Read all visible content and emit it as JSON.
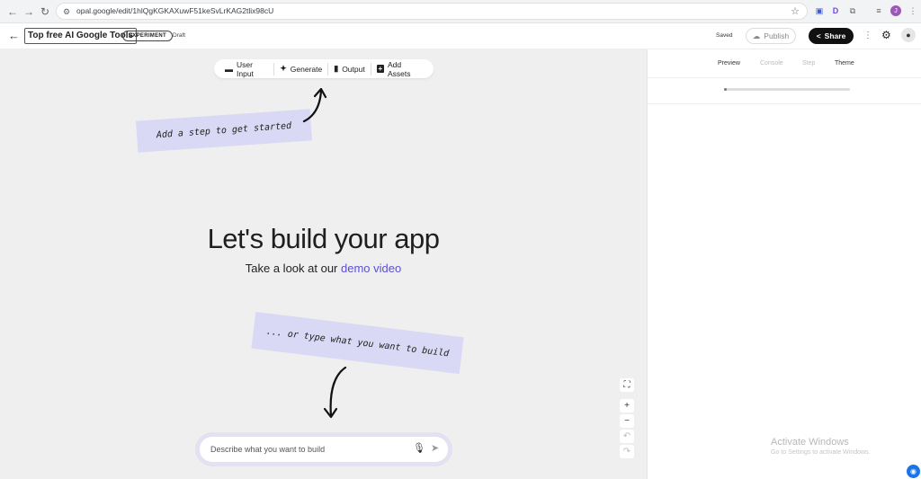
{
  "browser": {
    "url": "opal.google/edit/1hlQgKGKAXuwF51keSvLrKAG2tlix98cU",
    "back_icon": "←",
    "forward_icon": "→",
    "reload_icon": "↻",
    "site_icon": "⚙",
    "star_icon": "☆",
    "extensions": [
      {
        "name": "extension-1",
        "glyph": "▣",
        "color": "#3b5bdb"
      },
      {
        "name": "extension-d",
        "glyph": "D",
        "color": "#7048e8"
      },
      {
        "name": "puzzle",
        "glyph": "⧉",
        "color": "#5f6368"
      },
      {
        "name": "media",
        "glyph": "≡",
        "color": "#5f6368"
      }
    ],
    "profile_initial": "J",
    "menu_icon": "⋮"
  },
  "header": {
    "title": "Top free AI Google Tools",
    "badge": "EXPERIMENT",
    "status": "Draft",
    "saved": "Saved",
    "publish_label": "Publish",
    "share_label": "Share"
  },
  "toolbar": {
    "items": [
      {
        "label": "User Input",
        "icon": "▬"
      },
      {
        "label": "Generate",
        "icon": "✦"
      },
      {
        "label": "Output",
        "icon": "▮"
      },
      {
        "label": "Add Assets",
        "icon": "+"
      }
    ]
  },
  "canvas": {
    "note_top": "Add a step to get started",
    "note_bottom": "... or type what you want to build",
    "hero": "Let's build your app",
    "sub_prefix": "Take a look at our ",
    "sub_link": "demo video",
    "prompt_placeholder": "Describe what you want to build"
  },
  "panel": {
    "tabs": [
      "Preview",
      "Console",
      "Step",
      "Theme"
    ],
    "loading_progress": 0.02,
    "watermark_title": "Activate Windows",
    "watermark_sub": "Go to Settings to activate Windows."
  },
  "colors": {
    "accent": "#5b4fd1",
    "note_bg": "#d9d8f5",
    "canvas_bg": "#efefef"
  }
}
